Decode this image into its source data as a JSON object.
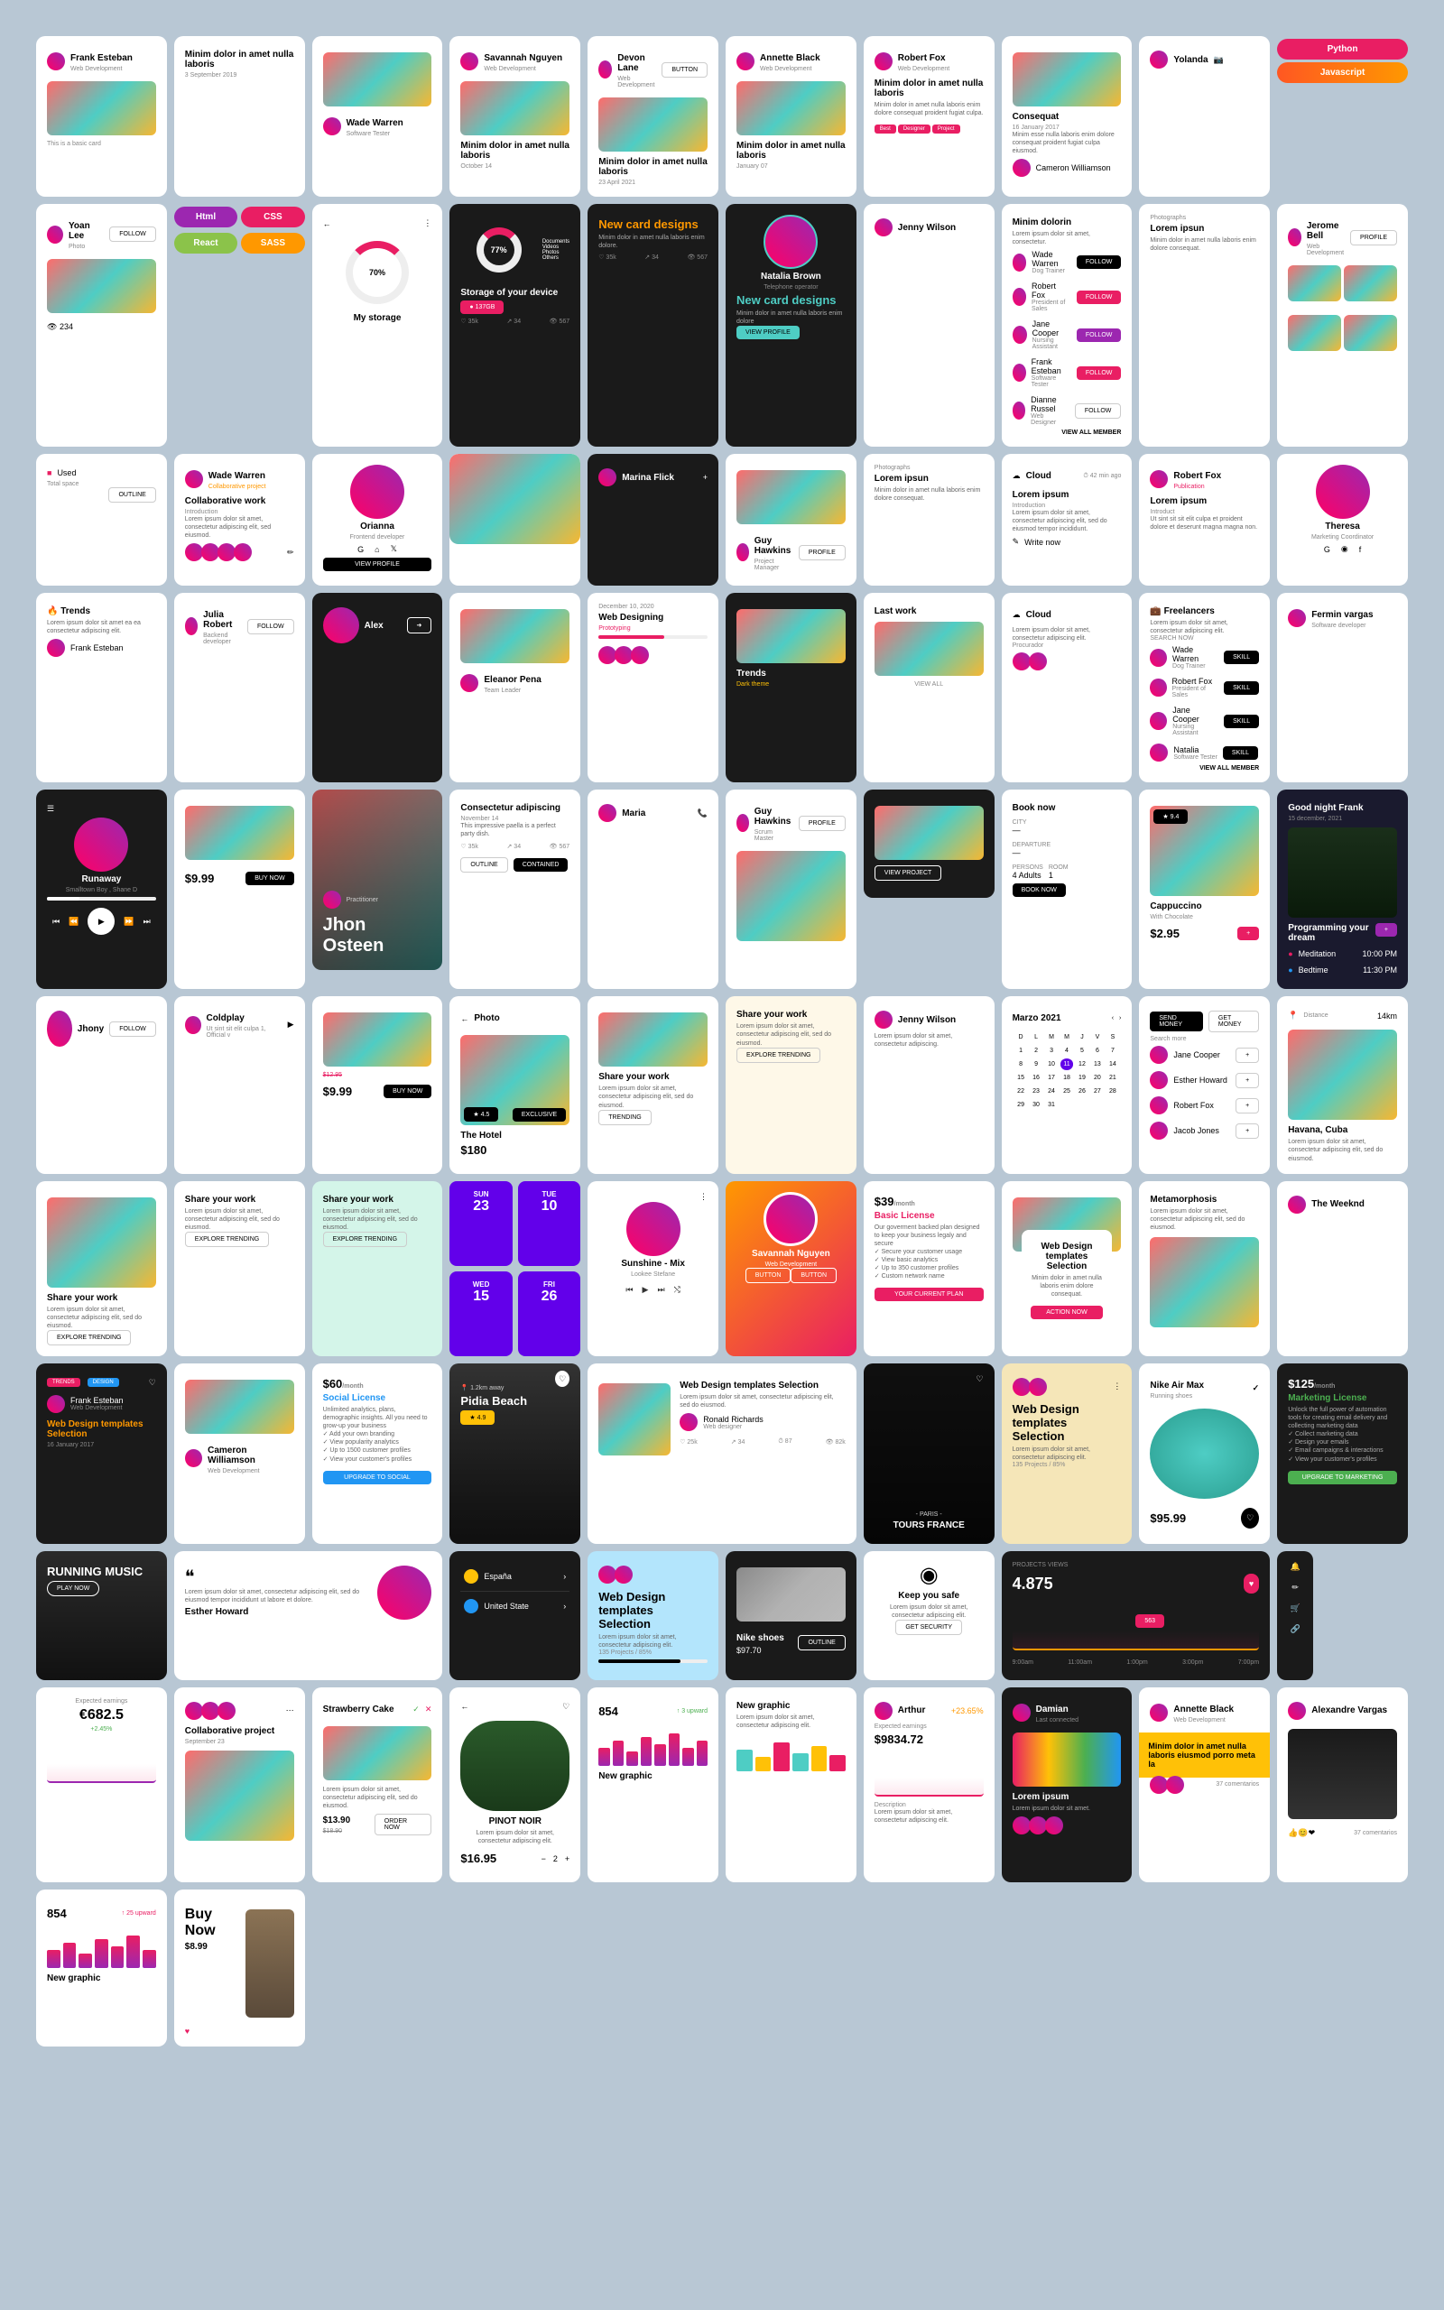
{
  "c1": {
    "name": "Frank Esteban",
    "role": "Web Development",
    "caption": "This is a basic card"
  },
  "c2": {
    "title": "Minim dolor in amet nulla laboris",
    "date": "3 September 2019"
  },
  "c3": {
    "name": "Wade Warren",
    "role": "Software Tester"
  },
  "c4": {
    "name": "Savannah Nguyen",
    "role": "Web Development",
    "title": "Minim dolor in amet nulla laboris",
    "date": "October 14"
  },
  "c5": {
    "name": "Devon Lane",
    "role": "Web Development",
    "title": "Minim dolor in amet nulla laboris",
    "date": "23 April 2021",
    "btn": "BUTTON"
  },
  "c6": {
    "name": "Annette Black",
    "role": "Web Development",
    "title": "Minim dolor in amet nulla laboris",
    "date": "January 07"
  },
  "c7": {
    "name": "Robert Fox",
    "role": "Web Development",
    "title": "Minim dolor in amet nulla laboris",
    "desc": "Minim dolor in amet nulla laboris enim dolore consequat proident fugiat culpa.",
    "tag1": "Best",
    "tag2": "Designer",
    "tag3": "Project"
  },
  "c8": {
    "title": "Consequat",
    "date": "16 January 2017",
    "desc": "Minim esse nulla laboris enim dolore consequat proident fugiat culpa eiusmod.",
    "name": "Cameron Williamson"
  },
  "pills": {
    "p1": "Python",
    "p2": "Javascript",
    "p3": "Html",
    "p4": "CSS",
    "p5": "React",
    "p6": "SASS"
  },
  "c9": {
    "title": "Minim dolorin",
    "desc": "Lorem ipsum dolor sit amet, consectetur.",
    "btn": "VIEW ALL MEMBER"
  },
  "people": [
    {
      "name": "Wade Warren",
      "role": "Dog Trainer",
      "btn": "FOLLOW"
    },
    {
      "name": "Robert Fox",
      "role": "President of Sales",
      "btn": "FOLLOW"
    },
    {
      "name": "Jane Cooper",
      "role": "Nursing Assistant",
      "btn": "FOLLOW"
    },
    {
      "name": "Frank Esteban",
      "role": "Software Tester",
      "btn": "FOLLOW"
    },
    {
      "name": "Dianne Russel",
      "role": "Web Designer",
      "btn": "FOLLOW"
    }
  ],
  "users": {
    "yolanda": "Yolanda",
    "jenny": "Jenny Wilson",
    "marina": "Marina Flick",
    "julia": "Julia Robert",
    "juliaRole": "Backend developer",
    "fermin": "Fermin vargas",
    "ferminRole": "Software developer",
    "maria": "Maria",
    "jhony": "Jhony",
    "alex": "Alex"
  },
  "yoan": {
    "name": "Yoan Lee",
    "role": "Photo",
    "views": "234",
    "btn": "FOLLOW"
  },
  "photo1": {
    "title": "Lorem ipsun",
    "role": "Photographs",
    "desc": "Minim dolor in amet nulla laboris enim dolore consequat."
  },
  "photo2": {
    "title": "Lorem ipsun",
    "role": "Photographs",
    "desc": "Minim dolor in amet nulla laboris enim dolore consequat."
  },
  "guy": {
    "name": "Guy Hawkins",
    "role": "Project Manager",
    "btn": "PROFILE"
  },
  "jerome": {
    "name": "Jerome Bell",
    "role": "Web Development",
    "btn": "PROFILE"
  },
  "storage": {
    "title": "My storage",
    "pct": "70%"
  },
  "deviceStorage": {
    "title": "Storage of your device",
    "pct": "77%",
    "size": "137GB",
    "l1": "Documents",
    "l2": "Videos",
    "l3": "Photos",
    "l4": "Others"
  },
  "newCard": {
    "title": "New card designs",
    "desc": "Minim dolor in amet nulla laboris enim dolore."
  },
  "natalia": {
    "name": "Natalia Brown",
    "role": "Telephone operator",
    "title": "New card designs",
    "desc": "Minim dolor in amet nulla laboris enim dolore",
    "btn": "VIEW PROFILE"
  },
  "used": {
    "label": "Used",
    "sub": "Total space",
    "btn": "OUTLINE"
  },
  "cloud": {
    "title": "Cloud",
    "time": "42 min ago",
    "h": "Lorem ipsum",
    "sub": "Introduction",
    "desc": "Lorem ipsum dolor sit amet, consectetur adipiscing elit, sed do eiusmod tempor incididunt.",
    "write": "Write now"
  },
  "wade": {
    "name": "Wade Warren",
    "role": "Collaborative project",
    "title": "Collaborative work",
    "sub": "Introduction",
    "desc": "Lorem ipsum dolor sit amet, consectetur adipiscing elit, sed eiusmod."
  },
  "orianna": {
    "name": "Orianna",
    "role": "Frontend developer",
    "btn": "VIEW PROFILE"
  },
  "rf": {
    "name": "Robert Fox",
    "role": "Publication",
    "title": "Lorem ipsum",
    "sub": "Introduct",
    "desc": "Ut sint sit sit elit culpa et proident dolore et deserunt magna magna non."
  },
  "theresa": {
    "name": "Theresa",
    "role": "Marketing Coordinator"
  },
  "trends": {
    "title": "Trends",
    "desc": "Lorem ipsum dolor sit amet ea ea consectetur adipiscing elit.",
    "name": "Frank Esteban"
  },
  "jw": {
    "name": "Jenny Wilson",
    "desc": "Lorem ipsum dolor sit amet, consectetur adipiscing."
  },
  "music1": {
    "title": "Sunshine - Mix",
    "artist": "Lookee Stefane"
  },
  "music2": {
    "title": "Runaway",
    "artist": "Smalltown Boy , Shane D"
  },
  "music3": {
    "name": "Coldplay",
    "desc": "Ut sint sit elit culpa 1, Official v"
  },
  "weeknd": {
    "name": "The Weeknd"
  },
  "frank2": {
    "name": "Frank Esteban",
    "role": "Web Development",
    "title": "Web Design templates Selection",
    "date": "16 January 2017",
    "tag1": "TRENDS",
    "tag2": "DESIGN"
  },
  "cal": {
    "month": "Marzo 2021",
    "days": [
      "D",
      "L",
      "M",
      "M",
      "J",
      "V",
      "S"
    ]
  },
  "webDesign1": {
    "title": "Web Design templates Selection",
    "desc": "Lorem ipsum dolor sit amet, consectetur adipiscing elit.",
    "stat": "135 Projects / 85%"
  },
  "webDesign2": {
    "title": "Web Design templates Selection",
    "desc": "Lorem ipsum dolor sit amet, consectetur adipiscing elit.",
    "stat": "135 Projects / 85%"
  },
  "sn": {
    "name": "Savannah Nguyen",
    "role": "Web Development",
    "btn1": "BUTTON",
    "btn2": "BUTTON"
  },
  "cw": {
    "name": "Cameron Williamson",
    "role": "Web Development"
  },
  "eleanor": {
    "name": "Eleanor Pena",
    "role": "Team Leader"
  },
  "price1": {
    "price": "$9.99",
    "btn": "BUY NOW"
  },
  "price2": {
    "price": "$9.99",
    "old": "$12.95",
    "btn": "BUY NOW"
  },
  "guy2": {
    "name": "Guy Hawkins",
    "role": "Scrum Master",
    "btn": "PROFILE"
  },
  "sendMoney": {
    "btn1": "SEND MONEY",
    "btn2": "GET MONEY",
    "label": "Search more"
  },
  "contacts": [
    {
      "name": "Jane Cooper"
    },
    {
      "name": "Esther Howard"
    },
    {
      "name": "Robert Fox"
    },
    {
      "name": "Jacob Jones"
    }
  ],
  "trendsDark": {
    "title": "Trends",
    "sub": "Dark theme"
  },
  "adipiscing": {
    "title": "Consectetur adipiscing",
    "date": "November 14",
    "desc": "This impressive paella is a perfect party dish.",
    "btn1": "OUTLINE",
    "btn2": "CONTAINED"
  },
  "lastWork": {
    "title": "Last work",
    "btn": "VIEW ALL"
  },
  "cloud2": {
    "title": "Cloud",
    "desc": "Lorem ipsum dolor sit amet, consectetur adipiscing elit.",
    "label": "Procurador"
  },
  "freelancers": {
    "title": "Freelancers",
    "desc": "Lorem ipsum dolor sit amet, consectetur adipiscing elit.",
    "search": "SEARCH NOW",
    "btn": "VIEW ALL MEMBER"
  },
  "flist": [
    {
      "name": "Wade Warren",
      "role": "Dog Trainer"
    },
    {
      "name": "Robert Fox",
      "role": "President of Sales"
    },
    {
      "name": "Jane Cooper",
      "role": "Nursing Assistant"
    },
    {
      "name": "Natalia",
      "role": "Software Tester"
    }
  ],
  "jhon": {
    "name": "Jhon Osteen"
  },
  "webDes": {
    "date": "December 10, 2020",
    "title": "Web Designing",
    "sub": "Prototyping"
  },
  "shoe": {
    "title": "Nike Air Max",
    "sub": "Running shoes",
    "price": "$95.99"
  },
  "shoe2": {
    "title": "Nike shoes",
    "price": "$97.70",
    "btn": "OUTLINE"
  },
  "strawberry": {
    "title": "Strawberry Cake",
    "desc": "Lorem ipsum dolor sit amet, consectetur adipiscing elit, sed do eiusmod.",
    "price": "$13.90",
    "old": "$18.90",
    "btn": "ORDER NOW"
  },
  "alex2": {
    "name": "Alexandre Vargas",
    "comments": "37 comentarios"
  },
  "license1": {
    "price": "$39",
    "period": "/month",
    "title": "Basic License",
    "desc": "Our goverment backed plan designed to keep your business legaly and secure",
    "f1": "Secure your customer usage",
    "f2": "View basic analytics",
    "f3": "Up to 350 customer profiles",
    "f4": "Custom network name",
    "btn": "YOUR CURRENT PLAN"
  },
  "license2": {
    "price": "$60",
    "period": "/month",
    "title": "Social License",
    "desc": "Unlimited analytics, plans, demographic insights. All you need to grow-up your business",
    "f1": "Add your own branding",
    "f2": "View popularity analytics",
    "f3": "Up to 1500 customer profiles",
    "f4": "View your customer's profiles",
    "btn": "UPGRADE TO SOCIAL"
  },
  "license3": {
    "price": "$125",
    "period": "/month",
    "title": "Marketing License",
    "desc": "Unlock the full power of automation tools for creating email delivery and collecting marketing data",
    "f1": "Collect marketing data",
    "f2": "Design your emails",
    "f3": "Email campaigns & interactions",
    "f4": "View your customer's profiles",
    "btn": "UPGRADE TO MARKETING"
  },
  "hotel": {
    "back": "Photo",
    "rating": "4.5",
    "tag": "EXCLUSIVE",
    "title": "The Hotel",
    "price": "$180"
  },
  "havana": {
    "label": "Distance",
    "dist": "14km",
    "title": "Havana, Cuba",
    "desc": "Lorem ipsum dolor sit amet, consectetur adipiscing elit, sed do eiusmod."
  },
  "pidia": {
    "dist": "1.2km away",
    "title": "Pidia Beach",
    "rating": "4.9"
  },
  "running": {
    "title": "RUNNING MUSIC",
    "btn": "PLAY NOW"
  },
  "safe": {
    "title": "Keep you safe",
    "desc": "Lorem ipsum dolor sit amet, consectetur adipiscing elit.",
    "btn": "GET SECURITY"
  },
  "webSel": {
    "title": "Web Design templates Selection",
    "desc": "Minim dolor in amet nulla laboris enim dolore consequat.",
    "btn": "ACTION NOW"
  },
  "book": {
    "title": "Book now",
    "l1": "CITY",
    "l2": "DEPARTURE",
    "l3": "PERSONS",
    "v1": "4 Adults",
    "l4": "ROOM",
    "v2": "1",
    "btn": "BOOK NOW"
  },
  "cappuccino": {
    "rating": "9.4",
    "title": "Cappuccino",
    "sub": "With Chocolate",
    "price": "$2.95"
  },
  "share1": {
    "title": "Share your work",
    "desc": "Lorem ipsum dolor sit amet, consectetur adipiscing elit, sed do eiusmod.",
    "btn": "TRENDING"
  },
  "share2": {
    "title": "Share your work",
    "desc": "Lorem ipsum dolor sit amet, consectetur adipiscing elit, sed do eiusmod.",
    "btn": "EXPLORE TRENDING"
  },
  "share3": {
    "title": "Share your work",
    "desc": "Lorem ipsum dolor sit amet, consectetur adipiscing elit, sed do eiusmod.",
    "btn": "EXPLORE TRENDING"
  },
  "share4": {
    "title": "Share your work",
    "desc": "Lorem ipsum dolor sit amet, consectetur adipiscing elit, sed do eiusmod.",
    "btn": "EXPLORE TRENDING"
  },
  "meta": {
    "title": "Metamorphosis",
    "desc": "Lorem ipsum dolor sit amet, consectetur adipiscing elit, sed do eiusmod."
  },
  "goodnight": {
    "greeting": "Good night Frank",
    "date": "15 december, 2021",
    "title": "Programming your dream",
    "m": "Meditation",
    "mt": "10:00 PM",
    "b": "Bedtime",
    "bt": "11:30 PM"
  },
  "dates": [
    {
      "d": "SUN",
      "n": "23"
    },
    {
      "d": "TUE",
      "n": "10"
    },
    {
      "d": "WED",
      "n": "15"
    },
    {
      "d": "FRI",
      "n": "26"
    }
  ],
  "webSel2": {
    "title": "Web Design templates Selection",
    "desc": "Lorem ipsum dolor sit amet, consectetur adipiscing elit, sed do eiusmod.",
    "name": "Ronald Richards",
    "role": "Web designer"
  },
  "quote": {
    "desc": "Lorem ipsum dolor sit amet, consectetur adipiscing elit, sed do eiusmod tempor incididunt ut labore et dolore.",
    "name": "Esther Howard"
  },
  "projViews": {
    "label": "PROJECTS VIEWS",
    "value": "4.875",
    "t1": "9:00am",
    "t2": "11:00am",
    "t3": "1:00pm",
    "t4": "3:00pm",
    "t5": "7:00pm"
  },
  "countries": {
    "c1": "España",
    "c2": "United State"
  },
  "paris": {
    "city": "- PARIS -",
    "title": "TOURS FRANCE"
  },
  "earnings": {
    "label": "Expected earnings",
    "value": "€682.5",
    "pct": "+2.45%"
  },
  "collab": {
    "title": "Collaborative project",
    "date": "September 23"
  },
  "graph1": {
    "value": "854",
    "change": "↑ 3 upward"
  },
  "graph2": {
    "value": "854",
    "change": "↑ 25 upward",
    "title": "New graphic"
  },
  "graph3": {
    "title": "New graphic",
    "desc": "Lorem ipsum dolor sit amet, consectetur adipiscing elit."
  },
  "arthur": {
    "name": "Arthur",
    "change": "+23.65%",
    "label": "Expected earnings",
    "value": "$9834.72",
    "sub": "Description",
    "desc": "Lorem ipsum dolor sit amet, consectetur adipiscing elit."
  },
  "damian": {
    "name": "Damian",
    "sub": "Last connected",
    "title": "Lorem ipsum",
    "desc": "Lorem ipsum dolor sit amet."
  },
  "annette": {
    "name": "Annette Black",
    "role": "Web Development",
    "title": "Minim dolor in amet nulla laboris eiusmod porro meta la"
  },
  "wine": {
    "title": "PINOT NOIR",
    "desc": "Lorem ipsum dolor sit amet, consectetur adipiscing elit.",
    "price": "$16.95",
    "qty": "2"
  },
  "buy": {
    "title": "Buy Now",
    "price": "$8.99"
  },
  "stats": {
    "like": "35k",
    "share": "34",
    "views": "567"
  },
  "btnFollow": "FOLLOW",
  "btnSkill": "SKILL"
}
